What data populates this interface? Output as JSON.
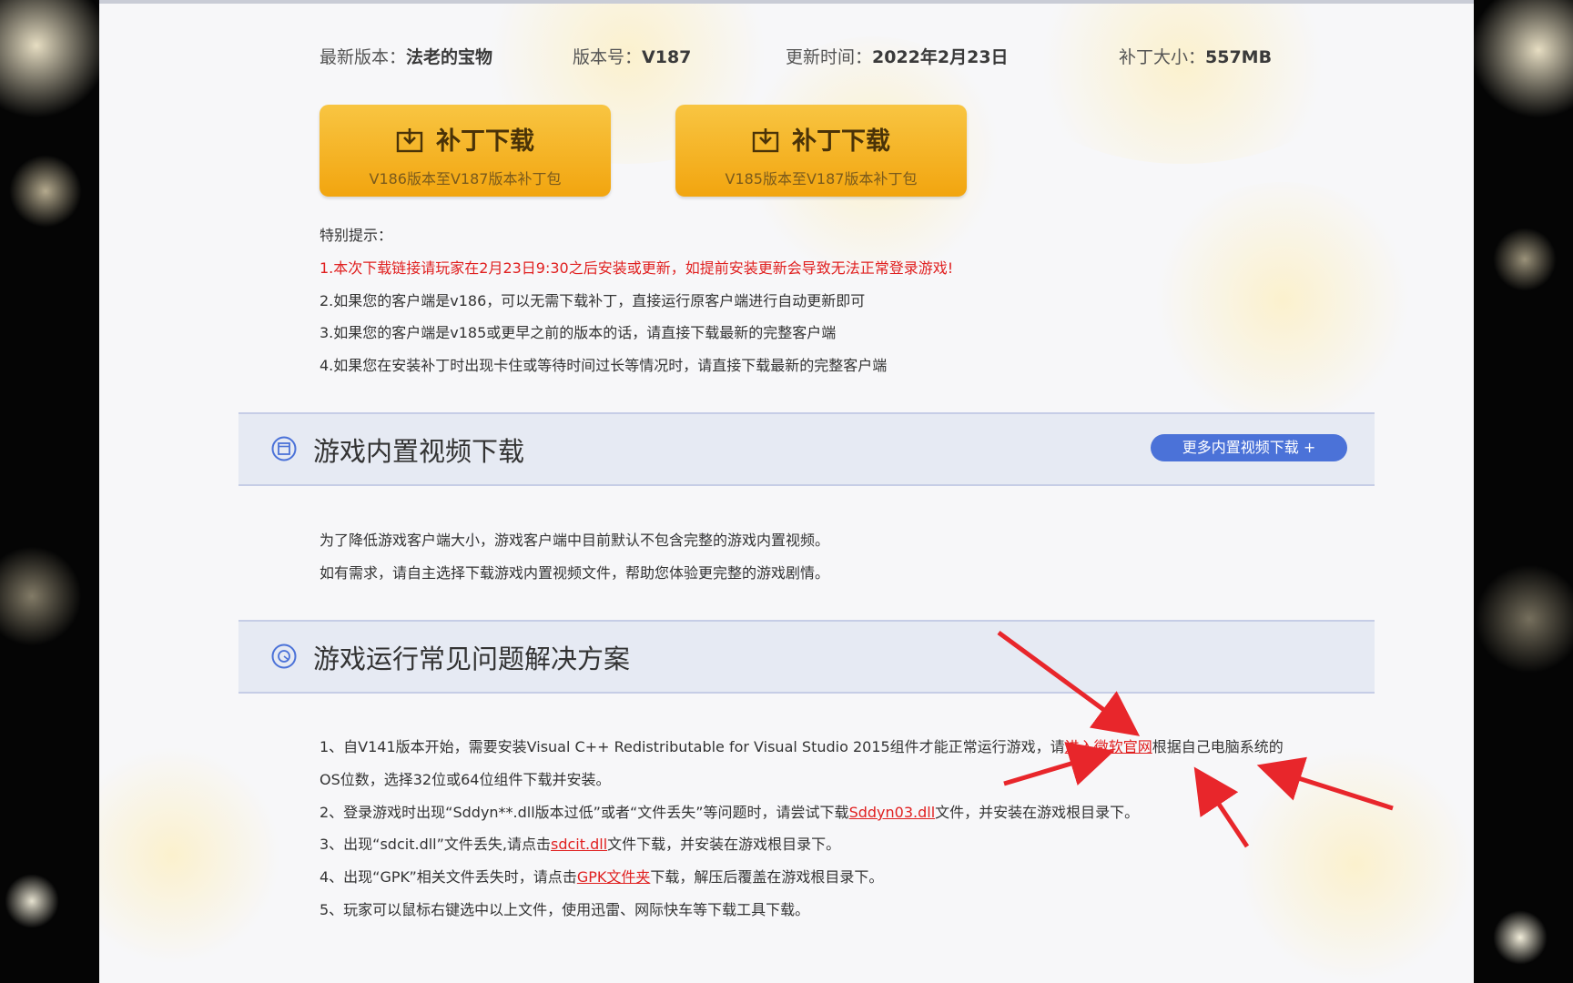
{
  "meta": {
    "latest_label": "最新版本：",
    "latest_value": "法老的宝物",
    "version_label": "版本号：",
    "version_value": "V187",
    "update_label": "更新时间：",
    "update_value": "2022年2月23日",
    "size_label": "补丁大小：",
    "size_value": "557MB"
  },
  "buttons": [
    {
      "label": "补丁下载",
      "sub": "V186版本至V187版本补丁包"
    },
    {
      "label": "补丁下载",
      "sub": "V185版本至V187版本补丁包"
    }
  ],
  "tips": {
    "title": "特别提示：",
    "items": [
      "1.本次下载链接请玩家在2月23日9:30之后安装或更新，如提前安装更新会导致无法正常登录游戏!",
      "2.如果您的客户端是v186，可以无需下载补丁，直接运行原客户端进行自动更新即可",
      "3.如果您的客户端是v185或更早之前的版本的话，请直接下载最新的完整客户端",
      "4.如果您在安装补丁时出现卡住或等待时间过长等情况时，请直接下载最新的完整客户端"
    ]
  },
  "video_section": {
    "title": "游戏内置视频下载",
    "more_button": "更多内置视频下载 +",
    "lines": [
      "为了降低游戏客户端大小，游戏客户端中目前默认不包含完整的游戏内置视频。",
      "如有需求，请自主选择下载游戏内置视频文件，帮助您体验更完整的游戏剧情。"
    ]
  },
  "faq_section": {
    "title": "游戏运行常见问题解决方案",
    "item1_pre": "1、自V141版本开始，需要安装Visual C++ Redistributable for Visual Studio 2015组件才能正常运行游戏，请",
    "item1_link": "进入微软官网",
    "item1_post": "根据自己电脑系统的",
    "item1_cont": "OS位数，选择32位或64位组件下载并安装。",
    "item2_pre": "2、登录游戏时出现“Sddyn**.dll版本过低”或者“文件丢失”等问题时，请尝试下载",
    "item2_link": "Sddyn03.dll",
    "item2_post": "文件，并安装在游戏根目录下。",
    "item3_pre": "3、出现“sdcit.dll”文件丢失,请点击",
    "item3_link": "sdcit.dll",
    "item3_post": "文件下载，并安装在游戏根目录下。",
    "item4_pre": "4、出现“GPK”相关文件丢失时，请点击",
    "item4_link": "GPK文件夹",
    "item4_post": "下载，解压后覆盖在游戏根目录下。",
    "item5": "5、玩家可以鼠标右键选中以上文件，使用迅雷、网际快车等下载工具下载。"
  },
  "colors": {
    "accent_blue": "#4b72d8",
    "button_gold": "#f2a50f",
    "warning_red": "#e02020",
    "arrow_red": "#e8262b"
  }
}
